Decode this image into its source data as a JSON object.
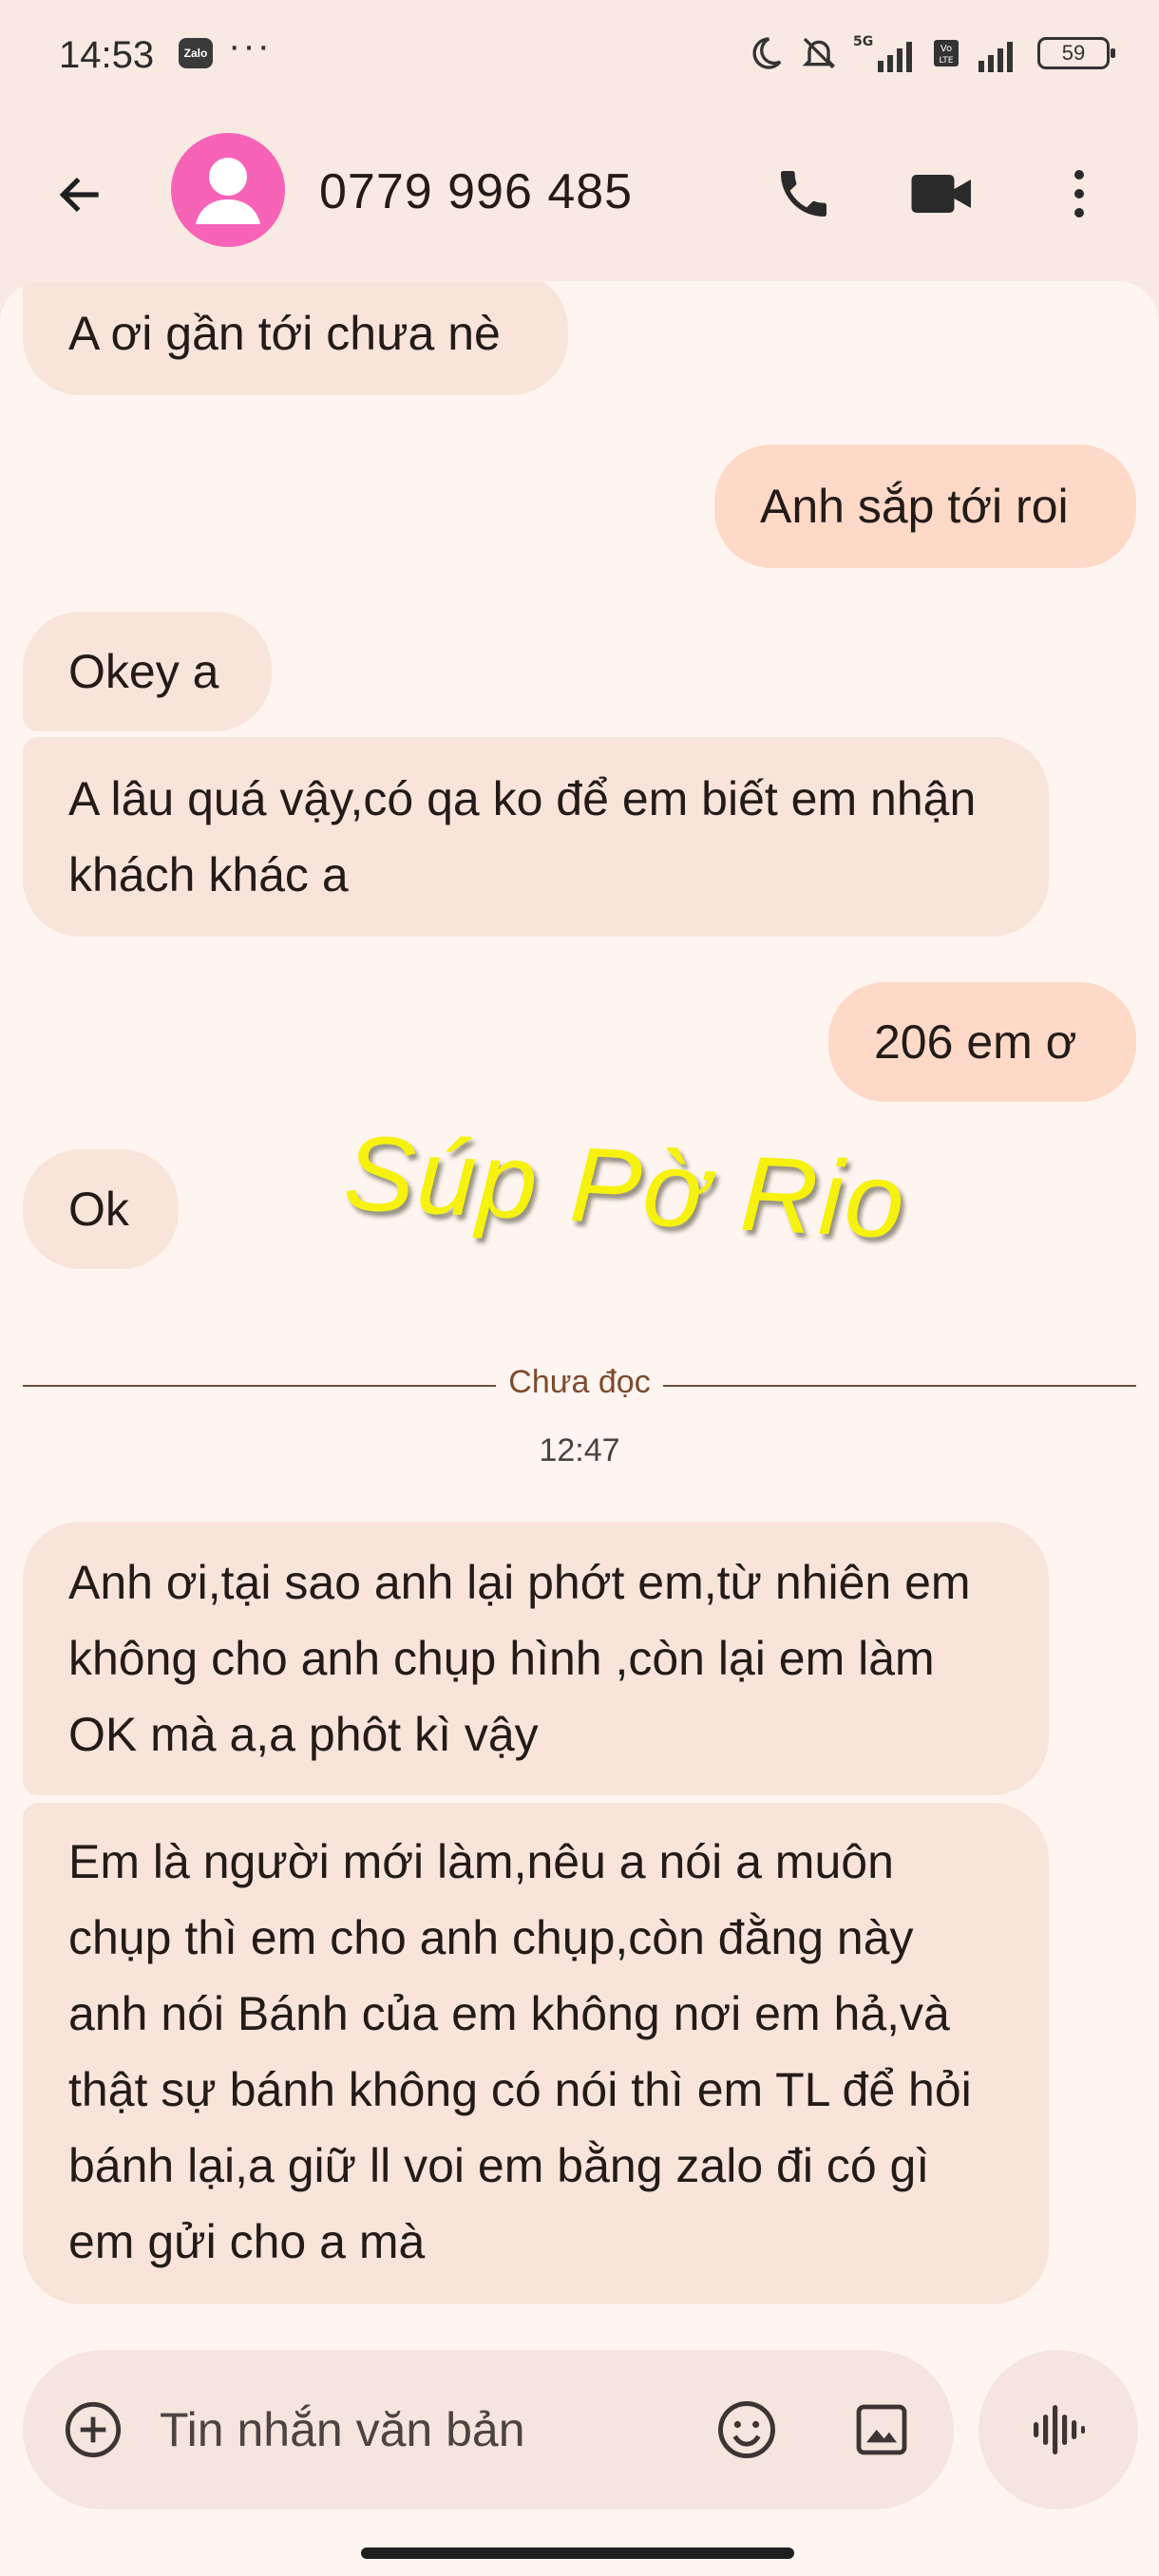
{
  "status_bar": {
    "time": "14:53",
    "app_badge": "Zalo",
    "more_notifications": "···",
    "network_label": "5G",
    "volte_label": "Vo LTE",
    "battery_level": "59",
    "icons": [
      "moon-icon",
      "mute-icon",
      "signal-icon",
      "battery-icon"
    ]
  },
  "app_bar": {
    "contact_name": "0779 996 485",
    "avatar_color": "#f763b7",
    "icons": [
      "back-arrow-icon",
      "phone-icon",
      "video-camera-icon",
      "more-vertical-icon"
    ]
  },
  "messages": [
    {
      "direction": "incoming",
      "text": "A ơi gần tới chưa nè"
    },
    {
      "direction": "outgoing",
      "text": "Anh sắp tới roi"
    },
    {
      "direction": "incoming",
      "text": "Okey a"
    },
    {
      "direction": "incoming",
      "text": "A lâu quá vậy,có qa ko để em biết em nhận khách khác a"
    },
    {
      "direction": "outgoing",
      "text": "206 em ơ"
    },
    {
      "direction": "incoming",
      "text": "Ok"
    },
    {
      "direction": "incoming",
      "text": "Anh ơi,tại sao anh lại phớt em,từ nhiên em không cho anh chụp hình ,còn lại em làm OK mà a,a phôt kì vậy"
    },
    {
      "direction": "incoming",
      "text": "Em là người mới làm,nêu a nói a muôn chụp thì em cho anh chụp,còn đằng này anh nói Bánh của em không nơi em hả,và thật sự bánh không có nói thì em TL để hỏi bánh lại,a giữ ll voi em bằng zalo đi có gì em gửi cho a mà"
    }
  ],
  "watermark": "Súp Pờ Rio",
  "unread_divider": "Chưa đọc",
  "unread_time": "12:47",
  "composer": {
    "placeholder": "Tin nhắn văn bản",
    "icons": [
      "add-circle-icon",
      "emoji-icon",
      "image-icon",
      "voice-waveform-icon"
    ]
  },
  "colors": {
    "background": "#f8e9e2",
    "sheet": "#fff5f0",
    "incoming_bubble": "#f9e4dc",
    "outgoing_bubble": "#ffd9c8",
    "watermark": "#f6f20e"
  }
}
